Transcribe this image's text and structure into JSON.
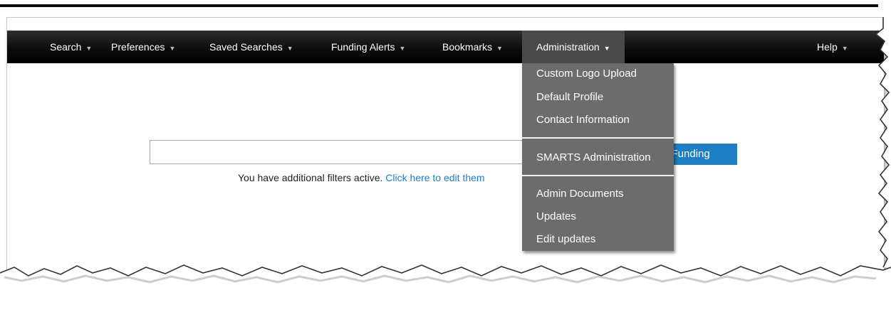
{
  "navbar": {
    "items": [
      {
        "label": "Search"
      },
      {
        "label": "Preferences"
      },
      {
        "label": "Saved Searches"
      },
      {
        "label": "Funding Alerts"
      },
      {
        "label": "Bookmarks"
      },
      {
        "label": "Administration"
      },
      {
        "label": "Help"
      }
    ],
    "caret_glyph": "▼"
  },
  "search": {
    "input_value": "",
    "button_label": "e Funding"
  },
  "filter_notice": {
    "text": "You have additional filters active. ",
    "link_text": "Click here to edit them"
  },
  "admin_menu": {
    "items": [
      {
        "label": "Custom Logo Upload"
      },
      {
        "label": "Default Profile"
      },
      {
        "label": "Contact Information"
      },
      {
        "label": "SMARTS Administration"
      },
      {
        "label": "Admin Documents"
      },
      {
        "label": "Updates"
      },
      {
        "label": "Edit updates"
      }
    ]
  },
  "colors": {
    "navbar_bg": "#000000",
    "active_nav_bg": "#4a4a4a",
    "menu_bg": "#6c6c6c",
    "accent": "#1e7ec3"
  },
  "icons": {
    "nav_caret": "chevron-down-icon"
  }
}
